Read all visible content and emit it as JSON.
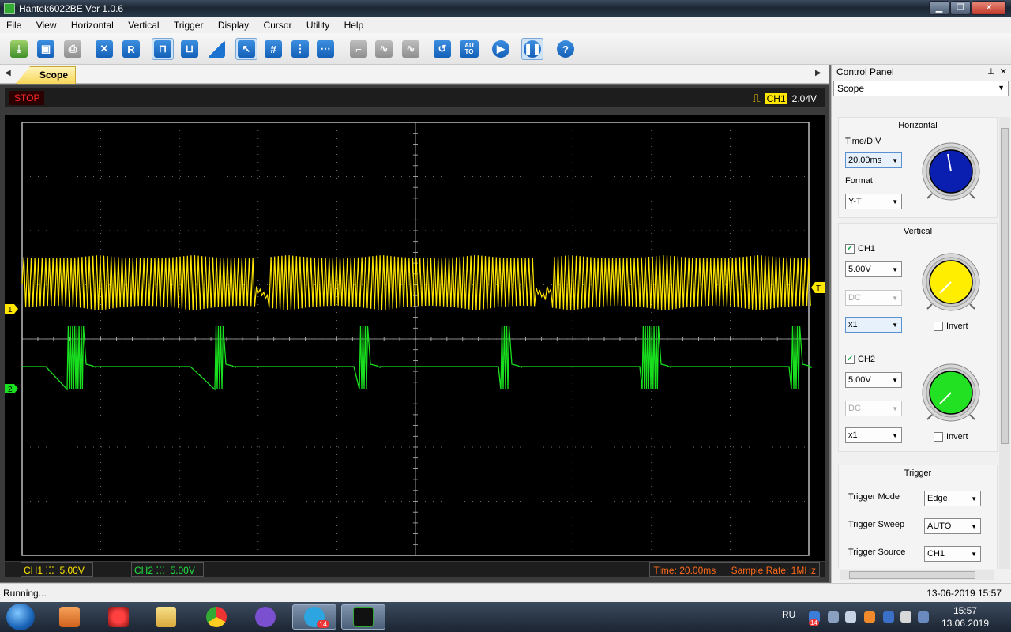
{
  "window": {
    "title": "Hantek6022BE Ver 1.0.6"
  },
  "menu": [
    "File",
    "View",
    "Horizontal",
    "Vertical",
    "Trigger",
    "Display",
    "Cursor",
    "Utility",
    "Help"
  ],
  "toolbar": {
    "buttons": [
      {
        "name": "open-button",
        "icon": "open-folder-icon",
        "label": ""
      },
      {
        "name": "save-button",
        "icon": "save-disk-icon",
        "label": ""
      },
      {
        "name": "print-button",
        "icon": "printer-icon",
        "label": ""
      },
      {
        "name": "measure-button",
        "icon": "measure-icon",
        "label": ""
      },
      {
        "name": "reference-button",
        "icon": "reference-icon",
        "label": "R"
      },
      {
        "name": "square-wave-button",
        "icon": "square-wave-icon",
        "label": ""
      },
      {
        "name": "pulse-button",
        "icon": "pulse-icon",
        "label": ""
      },
      {
        "name": "ramp-button",
        "icon": "ramp-icon",
        "label": ""
      },
      {
        "name": "cursor-select-button",
        "icon": "cursor-select-icon",
        "label": ""
      },
      {
        "name": "grid-button",
        "icon": "grid-icon",
        "label": ""
      },
      {
        "name": "vertical-cursor-button",
        "icon": "vertical-cursor-icon",
        "label": ""
      },
      {
        "name": "horizontal-cursor-button",
        "icon": "horizontal-cursor-icon",
        "label": ""
      },
      {
        "name": "step-button",
        "icon": "step-icon",
        "label": ""
      },
      {
        "name": "wave-button",
        "icon": "wave-icon",
        "label": ""
      },
      {
        "name": "sine-button",
        "icon": "sine-icon",
        "label": ""
      },
      {
        "name": "refresh-button",
        "icon": "refresh-icon",
        "label": ""
      },
      {
        "name": "auto-button",
        "icon": "auto-icon",
        "label": "AU TO"
      },
      {
        "name": "run-button",
        "icon": "play-icon",
        "label": ""
      },
      {
        "name": "pause-button",
        "icon": "pause-icon",
        "label": ""
      },
      {
        "name": "help-button",
        "icon": "help-icon",
        "label": "?"
      }
    ]
  },
  "tabs": [
    {
      "label": "Scope",
      "active": true
    }
  ],
  "scope": {
    "run_state": "STOP",
    "trigger": {
      "channel": "CH1",
      "level": "2.04V"
    },
    "ch1_marker": "1",
    "ch2_marker": "2",
    "trigger_marker": "T",
    "ch1_scale_label": "CH1",
    "ch1_scale_value": "5.00V",
    "ch2_scale_label": "CH2",
    "ch2_scale_value": "5.00V",
    "time_label": "Time: 20.00ms",
    "sample_rate_label": "Sample Rate: 1MHz",
    "colors": {
      "ch1": "#ffe600",
      "ch2": "#19e01f",
      "grid": "#8a8a8a",
      "background": "#000000"
    }
  },
  "control_panel": {
    "title": "Control Panel",
    "selector": "Scope",
    "horizontal": {
      "title": "Horizontal",
      "time_div_label": "Time/DIV",
      "time_div_value": "20.00ms",
      "format_label": "Format",
      "format_value": "Y-T",
      "knob_color": "#0a1eb0"
    },
    "vertical": {
      "title": "Vertical",
      "ch1": {
        "label": "CH1",
        "checked": true,
        "volts": "5.00V",
        "coupling": "DC",
        "probe": "x1",
        "invert_label": "Invert",
        "knob_color": "#ffee00"
      },
      "ch2": {
        "label": "CH2",
        "checked": true,
        "volts": "5.00V",
        "coupling": "DC",
        "probe": "x1",
        "invert_label": "Invert",
        "knob_color": "#22e022"
      }
    },
    "trigger": {
      "title": "Trigger",
      "mode_label": "Trigger Mode",
      "mode_value": "Edge",
      "sweep_label": "Trigger Sweep",
      "sweep_value": "AUTO",
      "source_label": "Trigger Source",
      "source_value": "CH1"
    }
  },
  "statusbar": {
    "text": "Running...",
    "datetime": "13-06-2019  15:57"
  },
  "taskbar": {
    "language": "RU",
    "clock_time": "15:57",
    "clock_date": "13.06.2019",
    "telegram_badge": "14",
    "tray_badge": "14"
  }
}
